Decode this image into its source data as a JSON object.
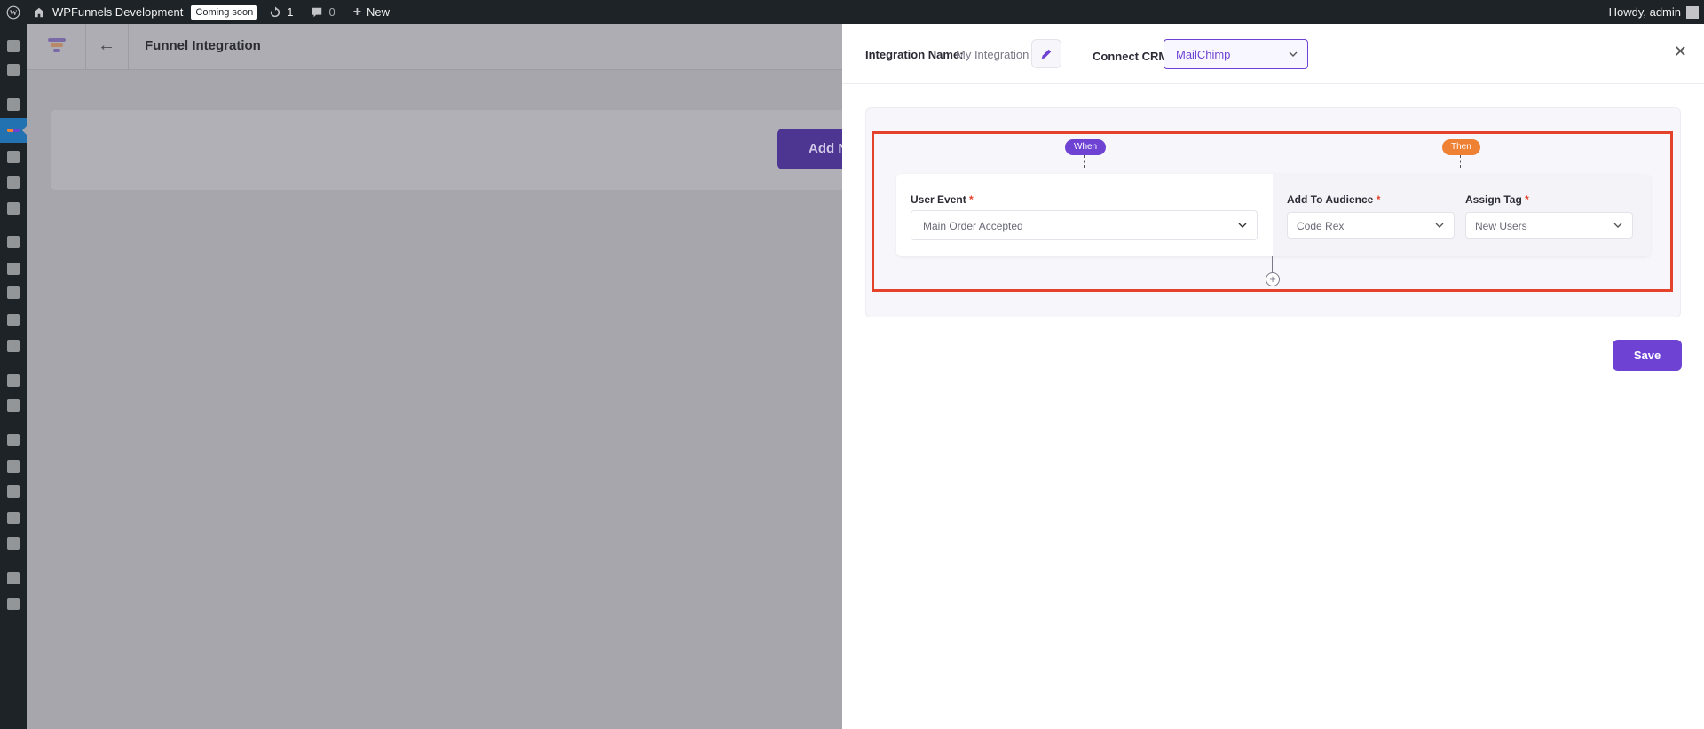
{
  "adminbar": {
    "site_name": "WPFunnels Development",
    "coming_soon": "Coming soon",
    "updates_count": "1",
    "comments_count": "0",
    "new_label": "New",
    "howdy": "Howdy, admin"
  },
  "plugin": {
    "title": "Funnel Integration",
    "add_button": "Add N"
  },
  "drawer": {
    "integration_name_label": "Integration Name:",
    "integration_name_value": "My Integration",
    "connect_crm_label": "Connect CRM",
    "crm_selected": "MailChimp",
    "when_label": "When",
    "then_label": "Then",
    "user_event_label": "User Event",
    "user_event_value": "Main Order Accepted",
    "audience_label": "Add To Audience",
    "audience_value": "Code Rex",
    "tag_label": "Assign Tag",
    "tag_value": "New Users",
    "required_mark": "*",
    "add_symbol": "+",
    "save_label": "Save"
  },
  "colors": {
    "accent": "#6e42d3",
    "then_orange": "#ee8134",
    "highlight_red": "#e4422b",
    "admin_bar": "#1d2327"
  }
}
